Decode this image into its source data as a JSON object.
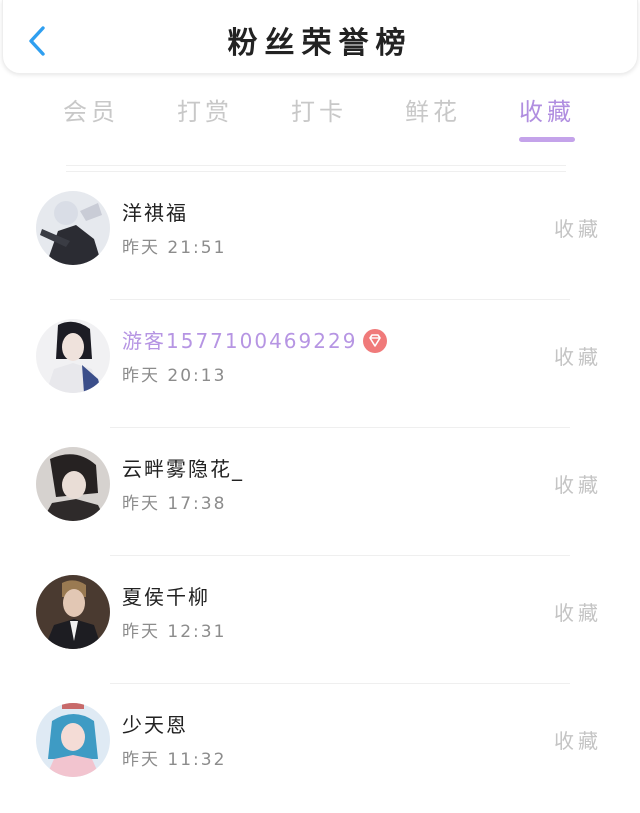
{
  "header": {
    "title": "粉丝荣誉榜"
  },
  "tabs": [
    {
      "label": "会员",
      "active": false
    },
    {
      "label": "打赏",
      "active": false
    },
    {
      "label": "打卡",
      "active": false
    },
    {
      "label": "鲜花",
      "active": false
    },
    {
      "label": "收藏",
      "active": true
    }
  ],
  "colors": {
    "accent": "#c4a3ea",
    "vip_name": "#b695e3",
    "vip_badge": "#f07a7a",
    "back_arrow": "#2f9ff0"
  },
  "fans": [
    {
      "name": "洋祺福",
      "time": "昨天 21:51",
      "action": "收藏",
      "vip": false
    },
    {
      "name": "游客1577100469229",
      "time": "昨天 20:13",
      "action": "收藏",
      "vip": true
    },
    {
      "name": "云畔雾隐花_",
      "time": "昨天 17:38",
      "action": "收藏",
      "vip": false
    },
    {
      "name": "夏侯千柳",
      "time": "昨天 12:31",
      "action": "收藏",
      "vip": false
    },
    {
      "name": "少天恩",
      "time": "昨天 11:32",
      "action": "收藏",
      "vip": false
    }
  ]
}
